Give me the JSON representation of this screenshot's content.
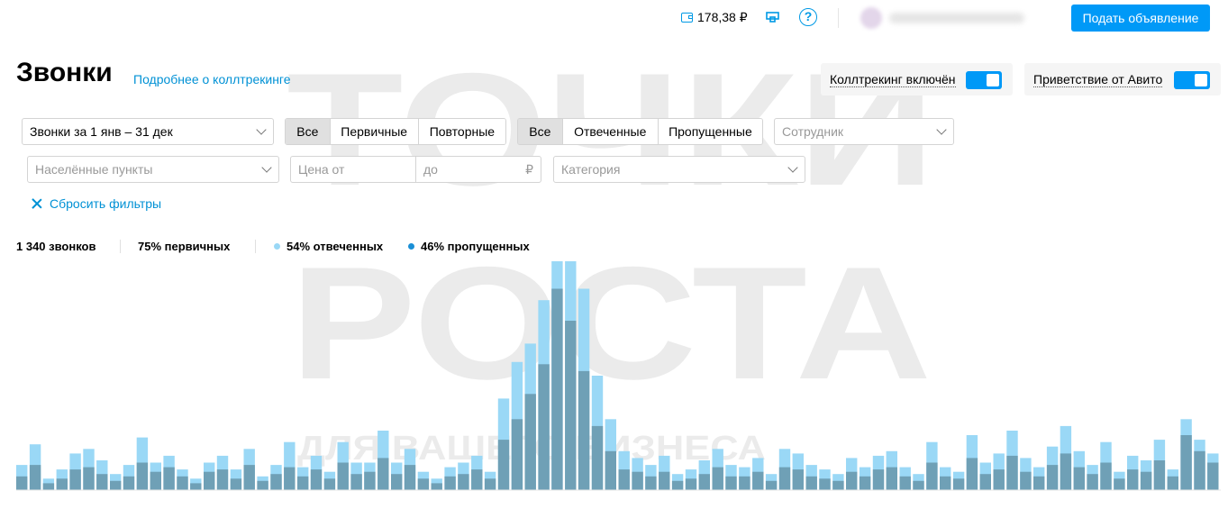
{
  "topbar": {
    "balance": "178,38 ₽",
    "post_button": "Подать объявление"
  },
  "header": {
    "title": "Звонки",
    "more_link": "Подробнее о коллтрекинге",
    "toggle_calltracking": "Коллтрекинг включён",
    "toggle_greeting": "Приветствие от Авито"
  },
  "filters": {
    "period": "Звонки за 1 янв – 31 дек",
    "type_segments": [
      "Все",
      "Первичные",
      "Повторные"
    ],
    "status_segments": [
      "Все",
      "Отвеченные",
      "Пропущенные"
    ],
    "employee_placeholder": "Сотрудник",
    "locations_placeholder": "Населённые пункты",
    "price_from_placeholder": "Цена от",
    "price_to_placeholder": "до",
    "currency": "₽",
    "category_placeholder": "Категория",
    "reset": "Сбросить фильтры"
  },
  "stats": {
    "total": "1 340 звонков",
    "primary": "75% первичных",
    "answered": "54% отвеченных",
    "missed": "46% пропущенных"
  },
  "colors": {
    "accent": "#0099f7",
    "answered": "#9ad8f6",
    "missed": "#6fa0b6"
  },
  "watermark": {
    "line1": "ТОЧКИ",
    "line2": "РОСТА",
    "line3": "ДЛЯ ВАШЕГО БИЗНЕСА"
  },
  "chart_data": {
    "type": "bar",
    "stacked": true,
    "title": "",
    "xlabel": "",
    "ylabel": "",
    "ylim": [
      0,
      100
    ],
    "series": [
      {
        "name": "отвеченных",
        "values": [
          5,
          9,
          2,
          4,
          7,
          8,
          6,
          3,
          5,
          11,
          4,
          5,
          3,
          2,
          4,
          6,
          4,
          7,
          2,
          4,
          11,
          4,
          6,
          3,
          9,
          5,
          4,
          12,
          5,
          7,
          3,
          2,
          4,
          5,
          6,
          3,
          18,
          25,
          22,
          28,
          45,
          41,
          36,
          22,
          14,
          8,
          6,
          5,
          7,
          3,
          4,
          6,
          8,
          5,
          4,
          6,
          3,
          8,
          7,
          5,
          4,
          3,
          6,
          4,
          6,
          7,
          4,
          3,
          9,
          4,
          3,
          10,
          5,
          7,
          11,
          6,
          4,
          8,
          12,
          7,
          4,
          9,
          3,
          6,
          5,
          9,
          3,
          7,
          5,
          4
        ]
      },
      {
        "name": "пропущенных",
        "values": [
          6,
          11,
          3,
          5,
          9,
          10,
          7,
          4,
          6,
          12,
          8,
          10,
          6,
          3,
          8,
          9,
          5,
          11,
          4,
          7,
          10,
          6,
          9,
          5,
          12,
          7,
          8,
          14,
          7,
          11,
          5,
          3,
          6,
          7,
          9,
          5,
          22,
          31,
          42,
          55,
          88,
          74,
          52,
          28,
          17,
          9,
          8,
          6,
          8,
          4,
          5,
          7,
          10,
          6,
          6,
          8,
          4,
          10,
          9,
          6,
          5,
          4,
          8,
          6,
          9,
          10,
          6,
          4,
          12,
          6,
          5,
          14,
          7,
          9,
          15,
          8,
          6,
          11,
          16,
          10,
          7,
          12,
          5,
          9,
          8,
          13,
          6,
          24,
          17,
          12
        ]
      }
    ]
  }
}
